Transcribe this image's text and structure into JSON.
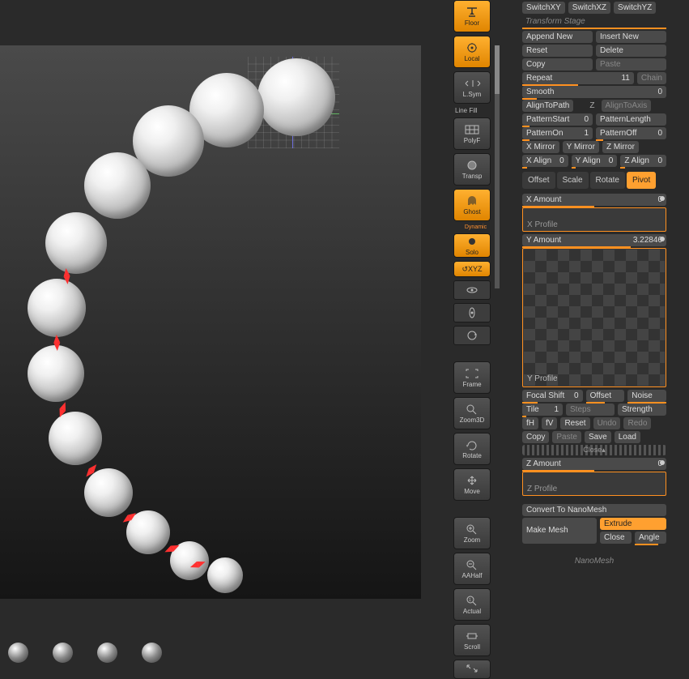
{
  "toolbar": {
    "floor": "Floor",
    "local": "Local",
    "lsym": "L.Sym",
    "lineFill": "Line Fill",
    "polyf": "PolyF",
    "transp": "Transp",
    "ghost": "Ghost",
    "dynamic": "Dynamic",
    "solo": "Solo",
    "xyz": "XYZ",
    "frame": "Frame",
    "zoom3d": "Zoom3D",
    "rotate": "Rotate",
    "move": "Move",
    "zoom": "Zoom",
    "aahalf": "AAHalf",
    "actual": "Actual",
    "scroll": "Scroll"
  },
  "panel": {
    "switchXY": "SwitchXY",
    "switchXZ": "SwitchXZ",
    "switchYZ": "SwitchYZ",
    "transformStage": "Transform Stage",
    "appendNew": "Append New",
    "insertNew": "Insert New",
    "reset": "Reset",
    "delete": "Delete",
    "copy": "Copy",
    "paste": "Paste",
    "repeat": {
      "name": "Repeat",
      "value": "11"
    },
    "chain": "Chain",
    "smooth": {
      "name": "Smooth",
      "value": "0"
    },
    "alignToPath": "AlignToPath",
    "alignToAxis": "AlignToAxis",
    "patternStart": {
      "name": "PatternStart",
      "value": "0"
    },
    "patternLength": "PatternLength",
    "patternOn": {
      "name": "PatternOn",
      "value": "1"
    },
    "patternOff": {
      "name": "PatternOff",
      "value": "0"
    },
    "xMirror": "X Mirror",
    "yMirror": "Y Mirror",
    "zMirror": "Z Mirror",
    "xAlign": {
      "name": "X Align",
      "value": "0"
    },
    "yAlign": {
      "name": "Y Align",
      "value": "0"
    },
    "zAlign": {
      "name": "Z Align",
      "value": "0"
    },
    "offsetTab": "Offset",
    "scaleTab": "Scale",
    "rotateTab": "Rotate",
    "pivotTab": "Pivot",
    "xAmount": {
      "name": "X Amount",
      "value": "0"
    },
    "xProfile": "X Profile",
    "yAmount": {
      "name": "Y Amount",
      "value": "3.22846"
    },
    "yProfile": "Y Profile",
    "focalShift": {
      "name": "Focal Shift",
      "value": "0"
    },
    "offset": "Offset",
    "noise": "Noise",
    "tile": {
      "name": "Tile",
      "value": "1"
    },
    "steps": "Steps",
    "strength": "Strength",
    "fH": "fH",
    "fV": "fV",
    "resetBtn": "Reset",
    "undo": "Undo",
    "redo": "Redo",
    "copy2": "Copy",
    "paste2": "Paste",
    "save": "Save",
    "load": "Load",
    "close": "Close▴",
    "zAmount": {
      "name": "Z Amount",
      "value": "0"
    },
    "zProfile": "Z Profile",
    "convertToNano": "Convert To NanoMesh",
    "makeMesh": "Make Mesh",
    "extrude": "Extrude",
    "closeBtn": "Close",
    "angle": "Angle",
    "nanoMesh": "NanoMesh",
    "z": "Z"
  }
}
